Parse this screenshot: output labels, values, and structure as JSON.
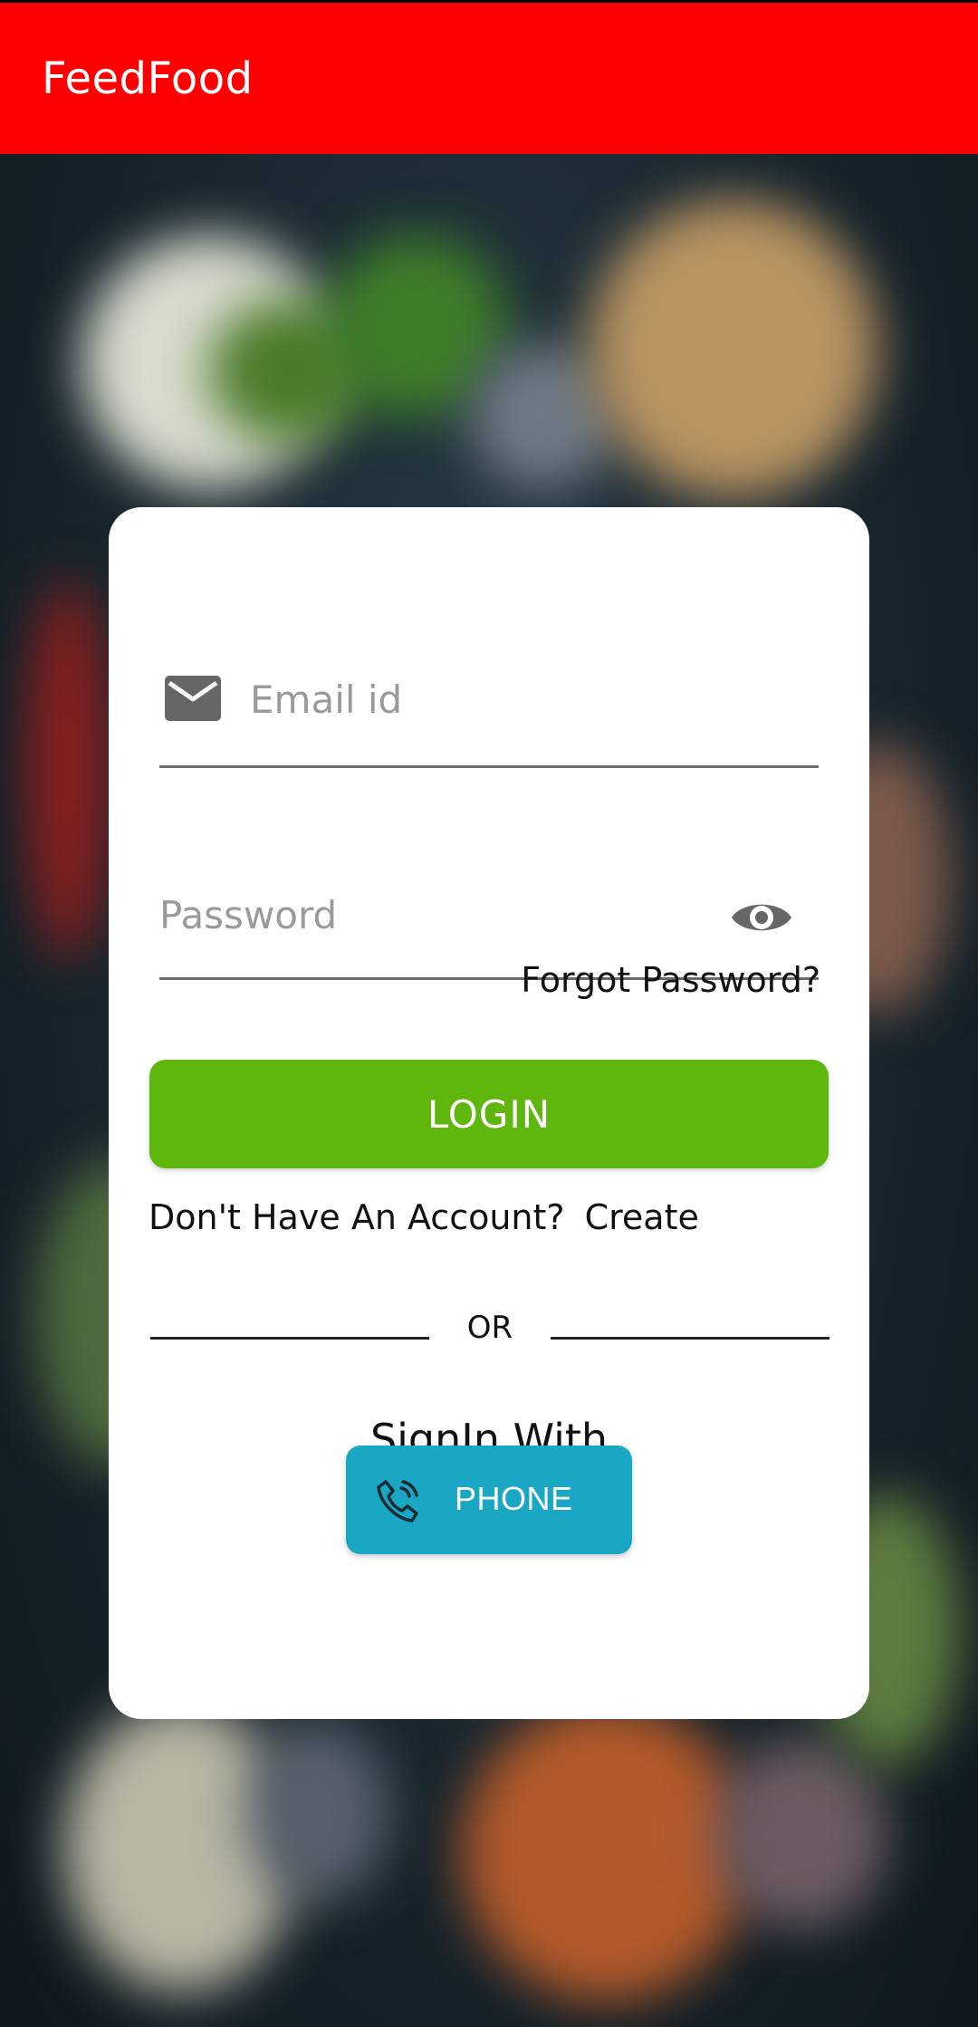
{
  "app_bar": {
    "title": "FeedFood",
    "color": "#ff0000"
  },
  "login_card": {
    "email": {
      "placeholder": "Email id",
      "icon": "mail-icon"
    },
    "password": {
      "placeholder": "Password",
      "icon": "eye-icon"
    },
    "forgot_password": "Forgot Password?",
    "login_button": "LOGIN",
    "account_prompt": "Don't Have An Account?",
    "create_link": "Create",
    "divider_text": "OR",
    "signin_with": "SignIn With",
    "phone_button": {
      "label": "PHONE",
      "icon": "phone-icon"
    }
  },
  "colors": {
    "login_button": "#5fb70d",
    "phone_button": "#1aa7c4"
  }
}
